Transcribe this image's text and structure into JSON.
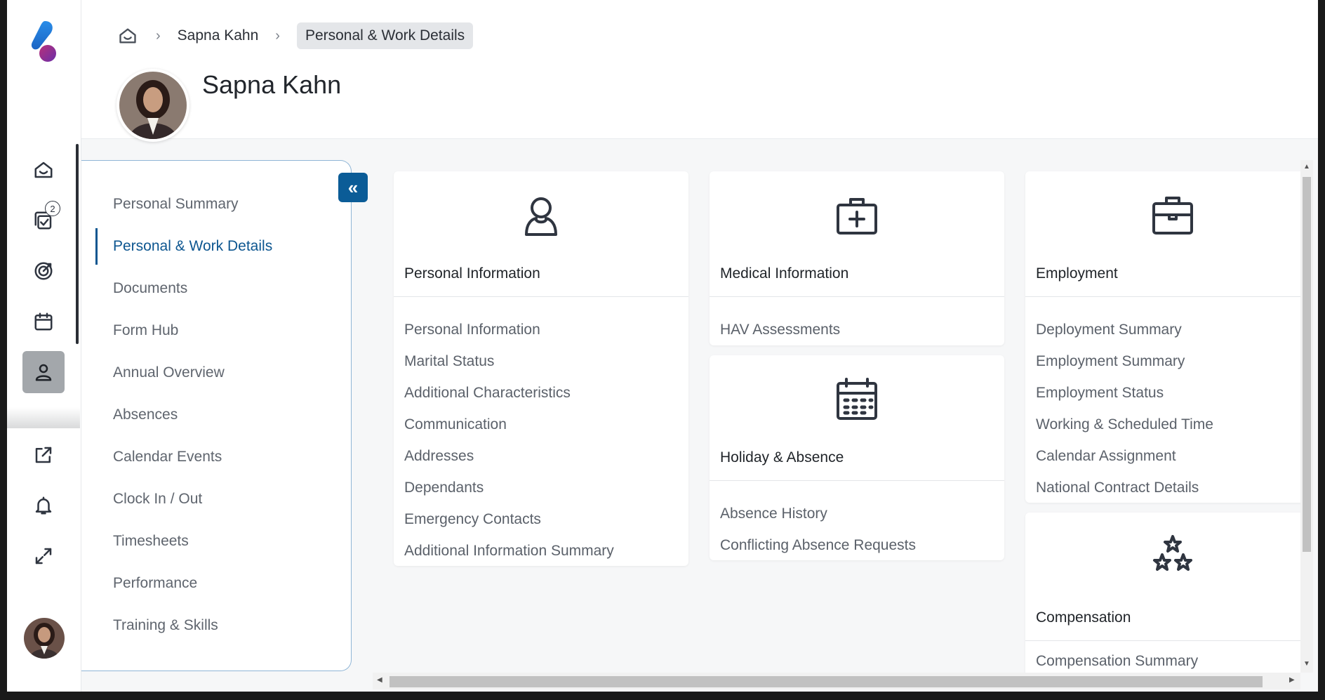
{
  "breadcrumb": {
    "home_icon": "home-icon",
    "items": [
      "Sapna Kahn",
      "Personal & Work Details"
    ]
  },
  "header": {
    "name": "Sapna Kahn"
  },
  "rail": {
    "icons": [
      "home-icon",
      "tasks-icon",
      "goals-icon",
      "calendar-icon",
      "person-icon",
      "external-link-icon",
      "bell-icon",
      "expand-icon"
    ],
    "tasks_badge": "2",
    "active": "person-icon"
  },
  "sidenav": {
    "collapse_icon": "«",
    "items": [
      "Personal Summary",
      "Personal & Work Details",
      "Documents",
      "Form Hub",
      "Annual Overview",
      "Absences",
      "Calendar Events",
      "Clock In / Out",
      "Timesheets",
      "Performance",
      "Training & Skills"
    ],
    "active_index": 1
  },
  "cards": {
    "personal": {
      "icon": "person-icon",
      "title": "Personal Information",
      "links": [
        "Personal Information",
        "Marital Status",
        "Additional Characteristics",
        "Communication",
        "Addresses",
        "Dependants",
        "Emergency Contacts",
        "Additional Information Summary"
      ]
    },
    "medical": {
      "icon": "medical-kit-icon",
      "title": "Medical Information",
      "links": [
        "HAV Assessments"
      ]
    },
    "holiday": {
      "icon": "calendar-icon",
      "title": "Holiday & Absence",
      "links": [
        "Absence History",
        "Conflicting Absence Requests"
      ]
    },
    "employment": {
      "icon": "briefcase-icon",
      "title": "Employment",
      "links": [
        "Deployment Summary",
        "Employment Summary",
        "Employment Status",
        "Working & Scheduled Time",
        "Calendar Assignment",
        "National Contract Details"
      ]
    },
    "compensation": {
      "icon": "stars-icon",
      "title": "Compensation",
      "links": [
        "Compensation Summary"
      ]
    }
  },
  "colors": {
    "accent": "#0b5c97",
    "active_rail": "#a3a7ab"
  }
}
